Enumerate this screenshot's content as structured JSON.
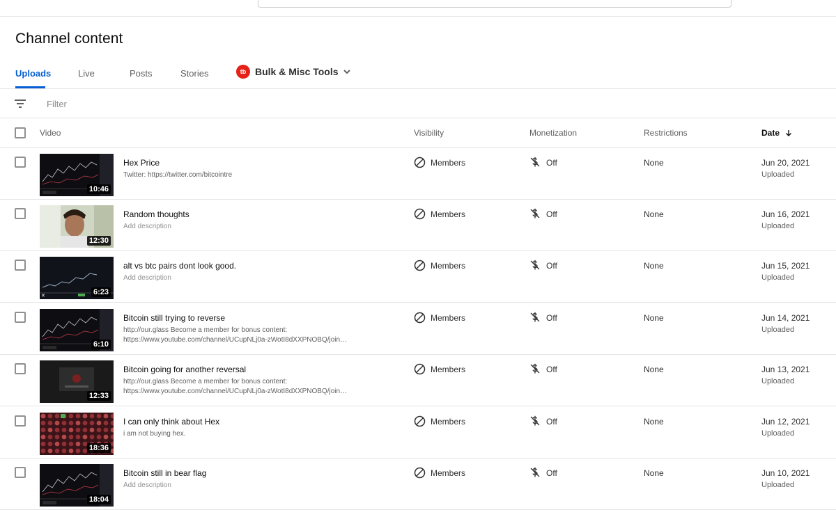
{
  "page": {
    "title": "Channel content"
  },
  "tabs": [
    {
      "label": "Uploads"
    },
    {
      "label": "Live"
    },
    {
      "label": "Posts"
    },
    {
      "label": "Stories"
    }
  ],
  "bulk_tools": {
    "logo": "tb",
    "label": "Bulk & Misc Tools"
  },
  "filter": {
    "placeholder": "Filter"
  },
  "columns": {
    "video": "Video",
    "visibility": "Visibility",
    "monetization": "Monetization",
    "restrictions": "Restrictions",
    "date": "Date"
  },
  "videos": [
    {
      "title": "Hex Price",
      "description": "Twitter: https://twitter.com/bitcointre",
      "duration": "10:46",
      "visibility": "Members",
      "monetization": "Off",
      "restrictions": "None",
      "date": "Jun 20, 2021",
      "status": "Uploaded"
    },
    {
      "title": "Random thoughts",
      "description": "Add description",
      "duration": "12:30",
      "visibility": "Members",
      "monetization": "Off",
      "restrictions": "None",
      "date": "Jun 16, 2021",
      "status": "Uploaded"
    },
    {
      "title": "alt vs btc pairs dont look good.",
      "description": "Add description",
      "duration": "6:23",
      "visibility": "Members",
      "monetization": "Off",
      "restrictions": "None",
      "date": "Jun 15, 2021",
      "status": "Uploaded"
    },
    {
      "title": "Bitcoin still trying to reverse",
      "description": "http://our.glass Become a member for bonus content:",
      "description2": "https://www.youtube.com/channel/UCupNLj0a-zWotI8dXXPNOBQ/join…",
      "duration": "6:10",
      "visibility": "Members",
      "monetization": "Off",
      "restrictions": "None",
      "date": "Jun 14, 2021",
      "status": "Uploaded"
    },
    {
      "title": "Bitcoin going for another reversal",
      "description": "http://our.glass Become a member for bonus content:",
      "description2": "https://www.youtube.com/channel/UCupNLj0a-zWotI8dXXPNOBQ/join…",
      "duration": "12:33",
      "visibility": "Members",
      "monetization": "Off",
      "restrictions": "None",
      "date": "Jun 13, 2021",
      "status": "Uploaded"
    },
    {
      "title": "I can only think about Hex",
      "description": "i am not buying hex.",
      "duration": "18:36",
      "visibility": "Members",
      "monetization": "Off",
      "restrictions": "None",
      "date": "Jun 12, 2021",
      "status": "Uploaded"
    },
    {
      "title": "Bitcoin still in bear flag",
      "description": "Add description",
      "duration": "18:04",
      "visibility": "Members",
      "monetization": "Off",
      "restrictions": "None",
      "date": "Jun 10, 2021",
      "status": "Uploaded"
    }
  ],
  "thumbnail_styles": [
    "chart",
    "person",
    "chart-light",
    "chart",
    "dark",
    "grid",
    "chart"
  ],
  "placeholder_description": "Add description",
  "colors": {
    "accent": "#065fd4",
    "bulk_logo": "#e62117"
  }
}
